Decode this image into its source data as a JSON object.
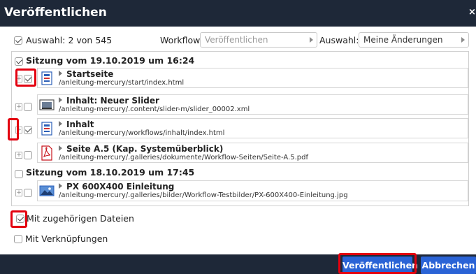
{
  "dialog": {
    "title": "Veröffentlichen",
    "close_label": "×"
  },
  "toolbar": {
    "selection_count_label": "Auswahl: 2 von 545",
    "workflow_label": "Workflow:",
    "workflow_value": "Veröffentlichen",
    "auswahl_label": "Auswahl:",
    "auswahl_value": "Meine Änderungen"
  },
  "sessions": [
    {
      "label": "Sitzung vom 19.10.2019 um 16:24",
      "checked": true,
      "items": [
        {
          "title": "Startseite",
          "path": "/anleitung-mercury/start/index.html",
          "icon": "page-icon",
          "checked": true
        },
        {
          "title": "Inhalt: Neuer Slider",
          "path": "/anleitung-mercury/.content/slider-m/slider_00002.xml",
          "icon": "slider-icon",
          "checked": false
        },
        {
          "title": "Inhalt",
          "path": "/anleitung-mercury/workflows/inhalt/index.html",
          "icon": "page-icon",
          "checked": true
        },
        {
          "title": "Seite A.5 (Kap. Systemüberblick)",
          "path": "/anleitung-mercury/.galleries/dokumente/Workflow-Seiten/Seite-A.5.pdf",
          "icon": "pdf-icon",
          "checked": false
        }
      ]
    },
    {
      "label": "Sitzung vom 18.10.2019 um 17:45",
      "checked": false,
      "items": [
        {
          "title": "PX 600X400 Einleitung",
          "path": "/anleitung-mercury/.galleries/bilder/Workflow-Testbilder/PX-600X400-Einleitung.jpg",
          "icon": "image-icon",
          "checked": false
        }
      ]
    }
  ],
  "options": {
    "related_files_label": "Mit zugehörigen Dateien",
    "related_files_checked": true,
    "links_label": "Mit Verknüpfungen",
    "links_checked": false
  },
  "footer": {
    "publish_label": "Veröffentlichen",
    "cancel_label": "Abbrechen"
  },
  "colors": {
    "titlebar_bg": "#1e2838",
    "button_bg": "#2a63d6",
    "highlight": "#e3000f"
  }
}
